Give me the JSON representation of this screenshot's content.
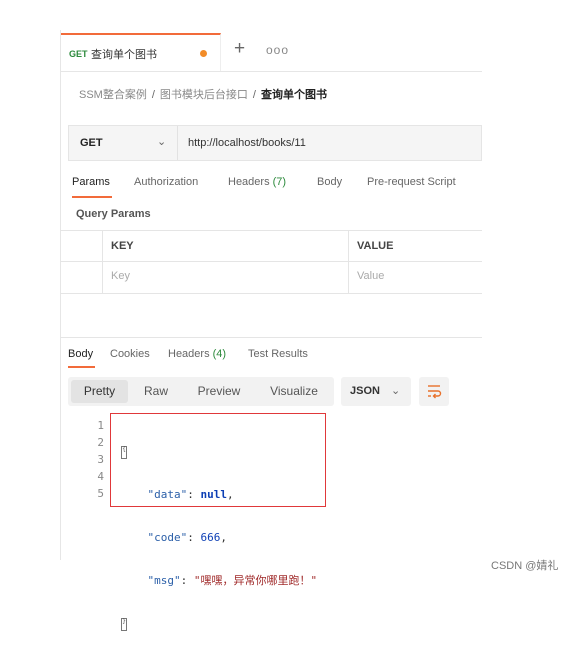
{
  "tab": {
    "method": "GET",
    "title": "查询单个图书",
    "more": "ooo"
  },
  "breadcrumb": {
    "part1": "SSM整合案例",
    "part2": "图书模块后台接口",
    "current": "查询单个图书",
    "sep": "/"
  },
  "request": {
    "method": "GET",
    "url": "http://localhost/books/11"
  },
  "request_tabs": {
    "params": "Params",
    "authorization": "Authorization",
    "headers": "Headers",
    "headers_count": "(7)",
    "body": "Body",
    "prerequest": "Pre-request Script"
  },
  "query_params": {
    "title": "Query Params",
    "col_key": "KEY",
    "col_value": "VALUE",
    "key_placeholder": "Key",
    "value_placeholder": "Value"
  },
  "response_tabs": {
    "body": "Body",
    "cookies": "Cookies",
    "headers": "Headers",
    "headers_count": "(4)",
    "tests": "Test Results"
  },
  "view_modes": {
    "pretty": "Pretty",
    "raw": "Raw",
    "preview": "Preview",
    "visualize": "Visualize",
    "format": "JSON"
  },
  "code": {
    "lines": [
      "1",
      "2",
      "3",
      "4",
      "5"
    ],
    "key_data": "\"data\"",
    "val_data": "null",
    "key_code": "\"code\"",
    "val_code": "666",
    "key_msg": "\"msg\"",
    "val_msg": "\"嘿嘿，异常你哪里跑！\""
  },
  "watermark": "CSDN @婧礼",
  "colors": {
    "accent": "#f26b3a",
    "get_green": "#2c8a3c",
    "highlight_red": "#e0383a"
  },
  "icons": {
    "plus": "plus-icon",
    "more": "more-icon",
    "chevron": "chevron-down-icon",
    "wrap": "wrap-lines-icon",
    "dot": "unsaved-dot-icon"
  }
}
